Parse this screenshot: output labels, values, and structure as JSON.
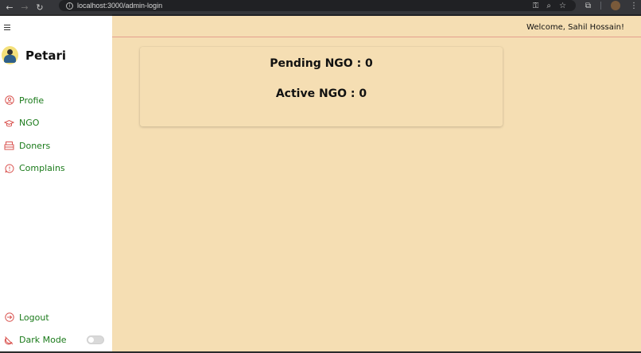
{
  "browser": {
    "url": "localhost:3000/admin-login"
  },
  "sidebar": {
    "brand": "Petari",
    "items": [
      {
        "label": "Profie",
        "icon": "user-circle-icon"
      },
      {
        "label": "NGO",
        "icon": "graduation-cap-icon"
      },
      {
        "label": "Doners",
        "icon": "donation-box-icon"
      },
      {
        "label": "Complains",
        "icon": "message-alert-icon"
      }
    ],
    "logout": {
      "label": "Logout",
      "icon": "logout-icon"
    },
    "dark_mode": {
      "label": "Dark Mode",
      "icon": "moon-off-icon",
      "enabled": false
    }
  },
  "header": {
    "welcome": "Welcome, Sahil Hossain!"
  },
  "stats": {
    "pending": "Pending NGO : 0",
    "active": "Active NGO : 0"
  },
  "colors": {
    "accent_green": "#1a7a1a",
    "icon_red": "#d9534f",
    "main_bg": "#f5deb3"
  }
}
